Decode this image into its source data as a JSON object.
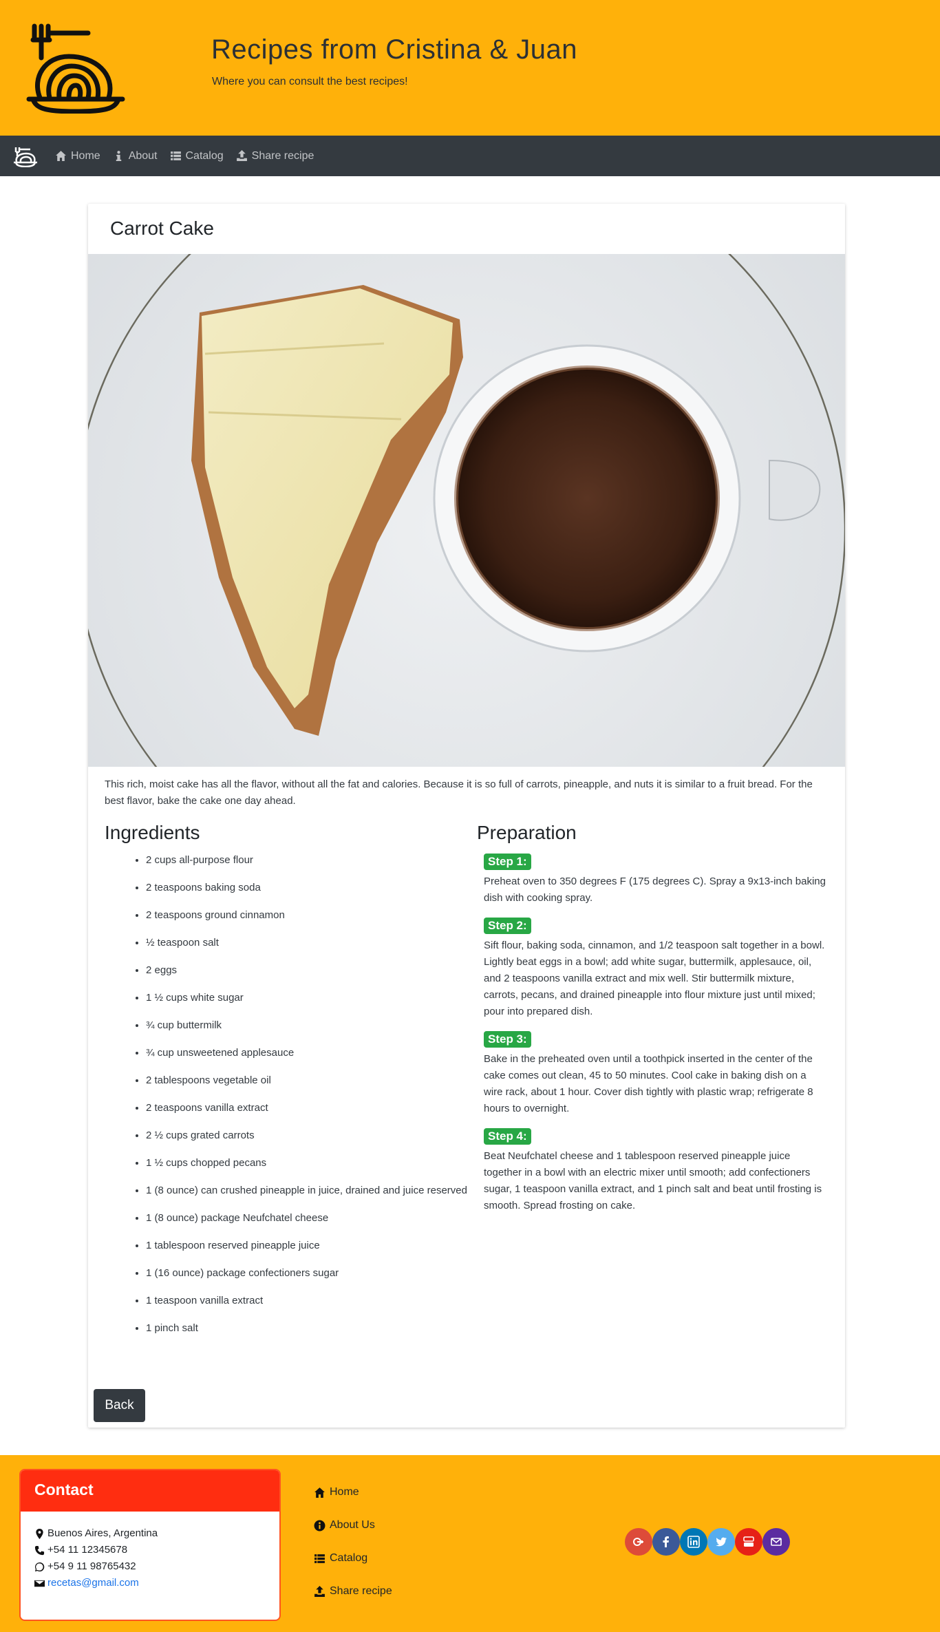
{
  "header": {
    "title": "Recipes from Cristina & Juan",
    "subtitle": "Where you can consult the best recipes!"
  },
  "nav": {
    "items": [
      {
        "label": "Home",
        "icon": "home-icon"
      },
      {
        "label": "About",
        "icon": "info-icon"
      },
      {
        "label": "Catalog",
        "icon": "list-icon"
      },
      {
        "label": "Share recipe",
        "icon": "upload-icon"
      }
    ]
  },
  "recipe": {
    "title": "Carrot Cake",
    "description": "This rich, moist cake has all the flavor, without all the fat and calories. Because it is so full of carrots, pineapple, and nuts it is similar to a fruit bread. For the best flavor, bake the cake one day ahead.",
    "ingredients_title": "Ingredients",
    "ingredients": [
      "2 cups all-purpose flour",
      "2 teaspoons baking soda",
      "2 teaspoons ground cinnamon",
      "½ teaspoon salt",
      "2 eggs",
      "1 ½ cups white sugar",
      "¾ cup buttermilk",
      "¾ cup unsweetened applesauce",
      "2 tablespoons vegetable oil",
      "2 teaspoons vanilla extract",
      "2 ½ cups grated carrots",
      "1 ½ cups chopped pecans",
      "1 (8 ounce) can crushed pineapple in juice, drained and juice reserved",
      "1 (8 ounce) package Neufchatel cheese",
      "1 tablespoon reserved pineapple juice",
      "1 (16 ounce) package confectioners sugar",
      "1 teaspoon vanilla extract",
      "1 pinch salt"
    ],
    "preparation_title": "Preparation",
    "steps": [
      {
        "label": "Step 1:",
        "text": "Preheat oven to 350 degrees F (175 degrees C). Spray a 9x13-inch baking dish with cooking spray."
      },
      {
        "label": "Step 2:",
        "text": "Sift flour, baking soda, cinnamon, and 1/2 teaspoon salt together in a bowl. Lightly beat eggs in a bowl; add white sugar, buttermilk, applesauce, oil, and 2 teaspoons vanilla extract and mix well. Stir buttermilk mixture, carrots, pecans, and drained pineapple into flour mixture just until mixed; pour into prepared dish."
      },
      {
        "label": "Step 3:",
        "text": "Bake in the preheated oven until a toothpick inserted in the center of the cake comes out clean, 45 to 50 minutes. Cool cake in baking dish on a wire rack, about 1 hour. Cover dish tightly with plastic wrap; refrigerate 8 hours to overnight."
      },
      {
        "label": "Step 4:",
        "text": "Beat Neufchatel cheese and 1 tablespoon reserved pineapple juice together in a bowl with an electric mixer until smooth; add confectioners sugar, 1 teaspoon vanilla extract, and 1 pinch salt and beat until frosting is smooth. Spread frosting on cake."
      }
    ],
    "back_label": "Back"
  },
  "footer": {
    "contact_title": "Contact",
    "address": "Buenos Aires, Argentina",
    "phone": "+54 11 12345678",
    "whatsapp": "+54 9 11 98765432",
    "email": "recetas@gmail.com",
    "links": [
      {
        "label": "Home",
        "icon": "home-icon"
      },
      {
        "label": "About Us",
        "icon": "info-icon"
      },
      {
        "label": "Catalog",
        "icon": "list-icon"
      },
      {
        "label": "Share recipe",
        "icon": "upload-icon"
      }
    ],
    "social": [
      {
        "name": "google-plus-icon",
        "color": "#dd4b39"
      },
      {
        "name": "facebook-icon",
        "color": "#3b5998"
      },
      {
        "name": "linkedin-icon",
        "color": "#0077b5"
      },
      {
        "name": "twitter-icon",
        "color": "#55acee"
      },
      {
        "name": "youtube-icon",
        "color": "#e62117"
      },
      {
        "name": "email-icon",
        "color": "#5b2ca0"
      }
    ]
  },
  "colors": {
    "header_bg": "#ffb10a",
    "navbar_bg": "#343a40",
    "step_badge": "#28a745",
    "contact_header": "#ff2d10"
  }
}
